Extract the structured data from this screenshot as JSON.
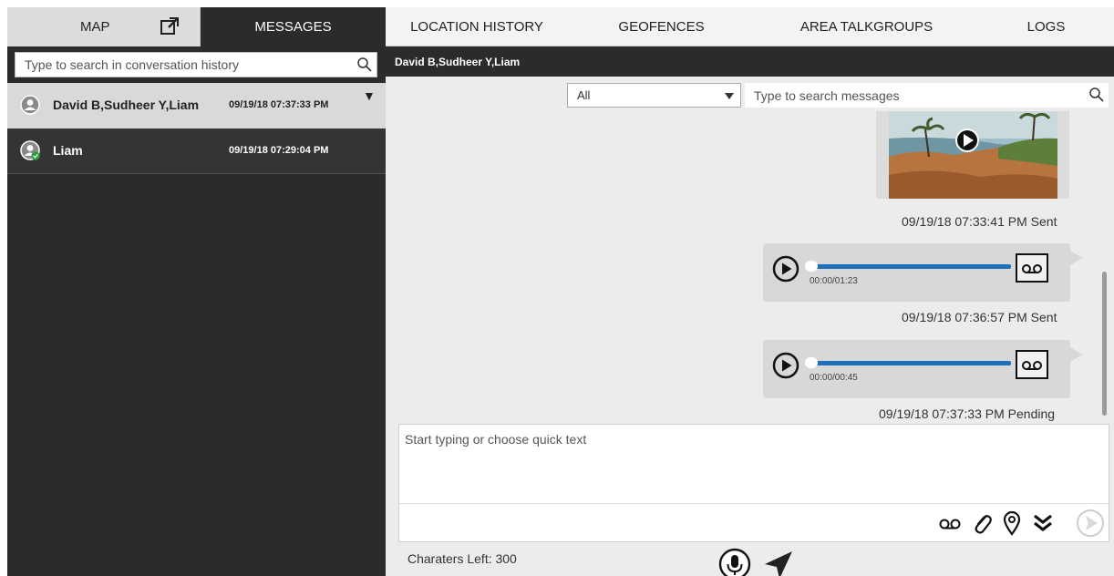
{
  "tabs": {
    "map": "MAP",
    "messages": "MESSAGES",
    "location_history": "LOCATION HISTORY",
    "geofences": "GEOFENCES",
    "area_talkgroups": "AREA TALKGROUPS",
    "logs": "LOGS"
  },
  "conversation_search": {
    "placeholder": "Type to search in conversation history"
  },
  "conversations": [
    {
      "name": "David B,Sudheer Y,Liam",
      "time": "09/19/18 07:37:33 PM"
    },
    {
      "name": "Liam",
      "time": "09/19/18 07:29:04 PM"
    }
  ],
  "chat": {
    "header": "David B,Sudheer Y,Liam",
    "filter_value": "All",
    "search_placeholder": "Type to search messages",
    "messages": [
      {
        "type": "image",
        "stamp": "09/19/18 07:33:41 PM Sent"
      },
      {
        "type": "audio",
        "duration": "00:00/01:23",
        "stamp": "09/19/18 07:36:57 PM Sent"
      },
      {
        "type": "audio",
        "duration": "00:00/00:45",
        "stamp": "09/19/18 07:37:33 PM Pending"
      }
    ],
    "compose_placeholder": "Start typing or choose quick text",
    "chars_left": "Charaters Left: 300"
  },
  "icons": {
    "map_tab": "external-window-icon",
    "search": "search-icon",
    "avatar": "user-avatar-icon",
    "audio_play": "play-icon",
    "voicemail": "voicemail-icon",
    "attach": "paperclip-icon",
    "location": "location-pin-icon",
    "more": "double-chevron-down-icon",
    "send": "send-icon",
    "mic": "microphone-icon",
    "send_big": "paper-plane-icon"
  },
  "colors": {
    "dark": "#2b2b2b",
    "accent_blue": "#1f6fb8",
    "status_green": "#2e9e3e"
  }
}
